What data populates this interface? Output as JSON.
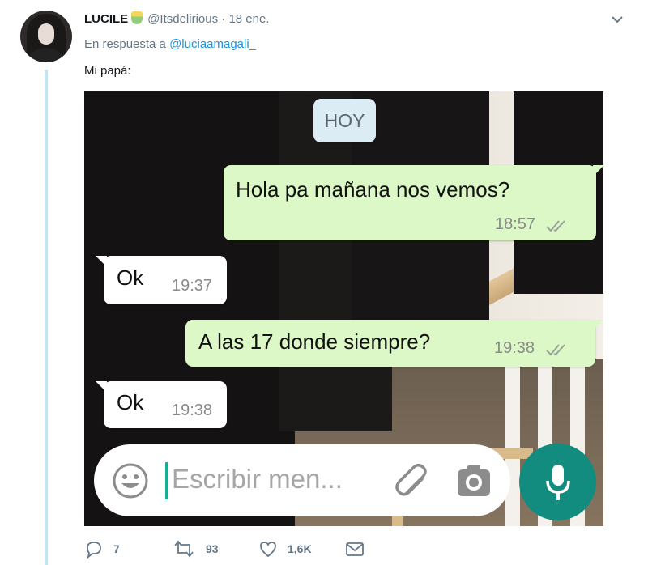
{
  "tweet": {
    "author_name": "LUCILE",
    "handle": "@Itsdelirious",
    "separator": "·",
    "date": "18 ene.",
    "reply_prefix": "En respuesta a",
    "reply_to": "@luciaamagali_",
    "text": "Mi papá:"
  },
  "chat": {
    "date_chip": "HOY",
    "messages": [
      {
        "direction": "outgoing",
        "text": "Hola pa mañana nos vemos?",
        "time": "18:57",
        "status": "read-double-check"
      },
      {
        "direction": "incoming",
        "text": "Ok",
        "time": "19:37"
      },
      {
        "direction": "outgoing",
        "text": "A las 17 donde siempre?",
        "time": "19:38",
        "status": "read-double-check"
      },
      {
        "direction": "incoming",
        "text": "Ok",
        "time": "19:38"
      }
    ],
    "composer_placeholder": "Escribir men...",
    "accent_color": "#128c7e"
  },
  "actions": {
    "replies": "7",
    "retweets": "93",
    "likes": "1,6K"
  }
}
